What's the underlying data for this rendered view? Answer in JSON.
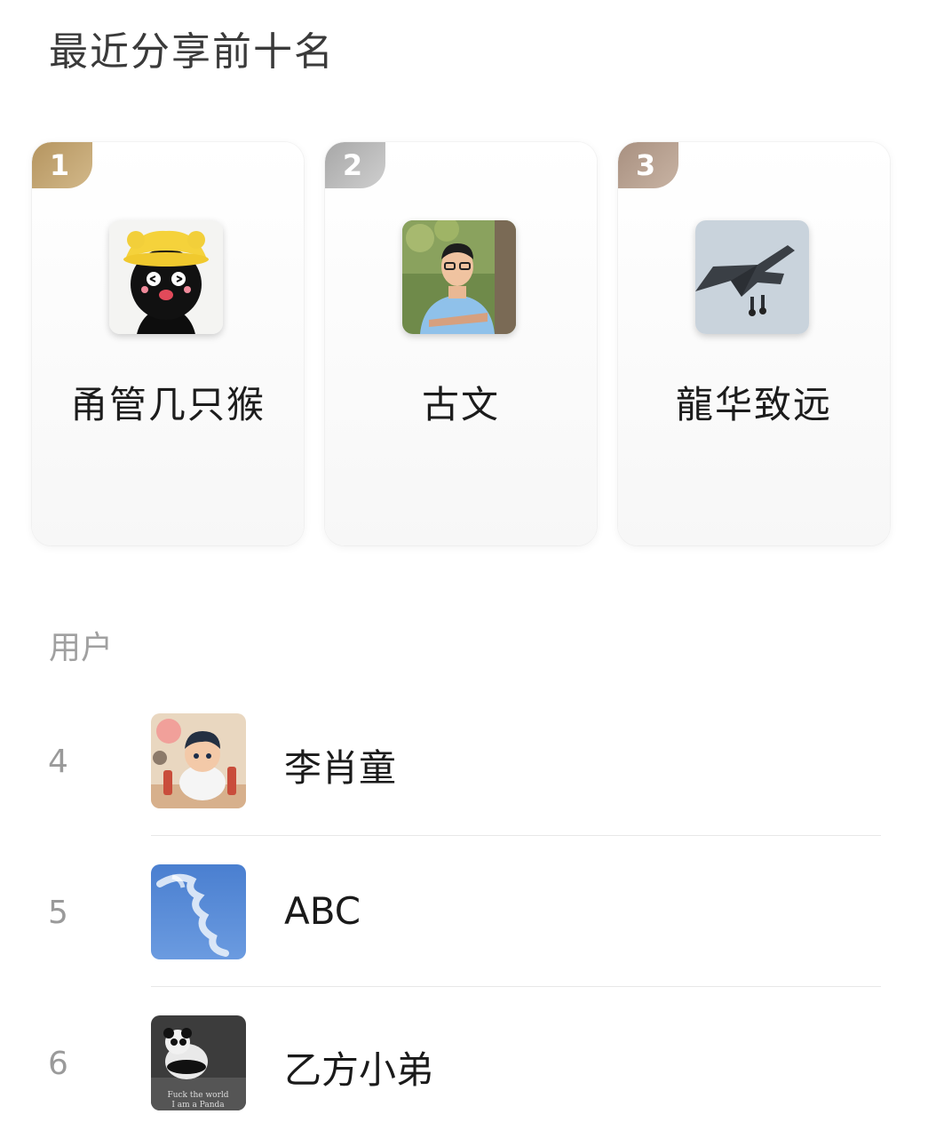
{
  "header": {
    "title": "最近分享前十名"
  },
  "top3": [
    {
      "rank": "1",
      "name": "甬管几只猴",
      "avatar": "cartoon-black-cat-avatar"
    },
    {
      "rank": "2",
      "name": "古文",
      "avatar": "man-portrait-avatar"
    },
    {
      "rank": "3",
      "name": "龍华致远",
      "avatar": "fighter-jet-avatar"
    }
  ],
  "section": {
    "label": "用户"
  },
  "list": [
    {
      "rank": "4",
      "name": "李肖童",
      "avatar": "cartoon-boy-avatar"
    },
    {
      "rank": "5",
      "name": "ABC",
      "avatar": "blue-sky-cloud-avatar"
    },
    {
      "rank": "6",
      "name": "乙方小弟",
      "avatar": "panda-avatar",
      "avatar_text": "Fuck the world I am a Panda"
    }
  ],
  "colors": {
    "gold": "#c2a574",
    "silver": "#bdbdbd",
    "bronze": "#b6a090"
  }
}
